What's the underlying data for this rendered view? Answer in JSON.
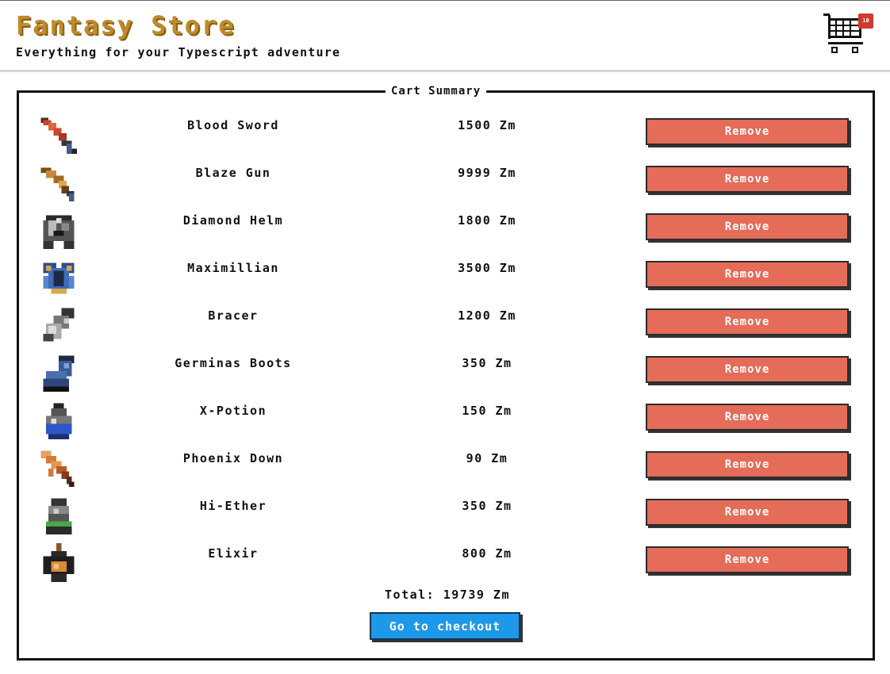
{
  "store": {
    "title": "Fantasy Store",
    "subtitle": "Everything for your Typescript adventure",
    "cart_count": "10"
  },
  "cart": {
    "legend": "Cart Summary",
    "items": [
      {
        "name": "Blood Sword",
        "price": "1500 Zm",
        "icon": "sword-icon"
      },
      {
        "name": "Blaze Gun",
        "price": "9999 Zm",
        "icon": "gun-icon"
      },
      {
        "name": "Diamond Helm",
        "price": "1800 Zm",
        "icon": "helmet-icon"
      },
      {
        "name": "Maximillian",
        "price": "3500 Zm",
        "icon": "armor-icon"
      },
      {
        "name": "Bracer",
        "price": "1200 Zm",
        "icon": "bracer-icon"
      },
      {
        "name": "Germinas Boots",
        "price": "350 Zm",
        "icon": "boots-icon"
      },
      {
        "name": "X-Potion",
        "price": "150 Zm",
        "icon": "potion-icon"
      },
      {
        "name": "Phoenix Down",
        "price": "90 Zm",
        "icon": "feather-icon"
      },
      {
        "name": "Hi-Ether",
        "price": "350 Zm",
        "icon": "ether-icon"
      },
      {
        "name": "Elixir",
        "price": "800 Zm",
        "icon": "elixir-icon"
      }
    ],
    "remove_label": "Remove",
    "total": "Total: 19739 Zm",
    "checkout_label": "Go to checkout"
  },
  "colors": {
    "title": "#bf8a2a",
    "remove_button": "#e46c58",
    "checkout_button": "#1e98e8",
    "badge": "#d03a2c"
  }
}
